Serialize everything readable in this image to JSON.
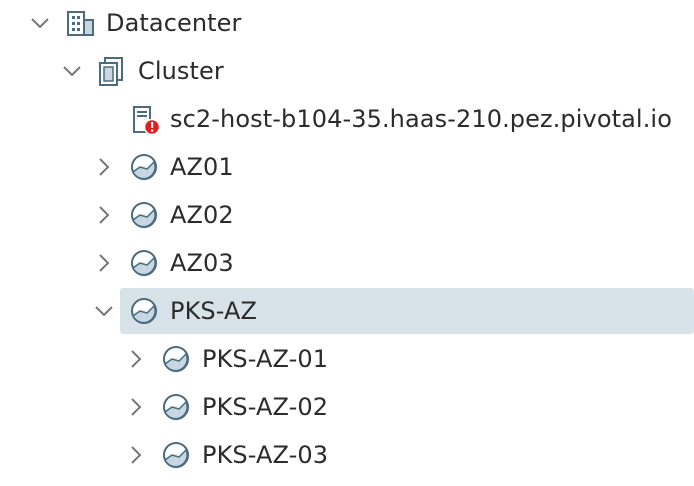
{
  "tree": {
    "items": [
      {
        "label": "Datacenter",
        "icon": "datacenter-icon",
        "expanded": true
      },
      {
        "label": "Cluster",
        "icon": "cluster-icon",
        "expanded": true
      },
      {
        "label": "sc2-host-b104-35.haas-210.pez.pivotal.io",
        "icon": "host-error-icon",
        "status": "error"
      },
      {
        "label": "AZ01",
        "icon": "resource-pool-icon",
        "expanded": false
      },
      {
        "label": "AZ02",
        "icon": "resource-pool-icon",
        "expanded": false
      },
      {
        "label": "AZ03",
        "icon": "resource-pool-icon",
        "expanded": false
      },
      {
        "label": "PKS-AZ",
        "icon": "resource-pool-icon",
        "expanded": true,
        "selected": true
      },
      {
        "label": "PKS-AZ-01",
        "icon": "resource-pool-icon",
        "expanded": false
      },
      {
        "label": "PKS-AZ-02",
        "icon": "resource-pool-icon",
        "expanded": false
      },
      {
        "label": "PKS-AZ-03",
        "icon": "resource-pool-icon",
        "expanded": false
      }
    ]
  },
  "colors": {
    "selected_bg": "#d8e3e9",
    "icon_stroke": "#4a6b80",
    "icon_fill": "#c8d8e2",
    "error_red": "#e02020",
    "chevron": "#777777"
  }
}
